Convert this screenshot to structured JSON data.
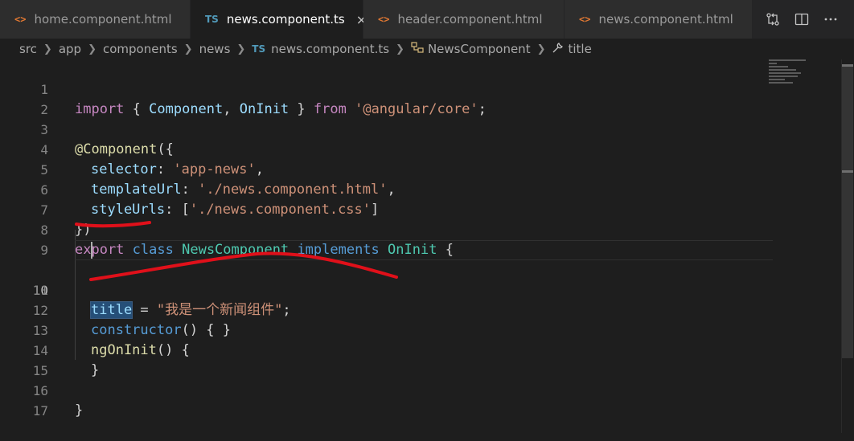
{
  "tabs": [
    {
      "label": "home.component.html",
      "icon": "html-file-icon",
      "glyph": "<>"
    },
    {
      "label": "news.component.ts",
      "icon": "typescript-file-icon",
      "glyph": "TS",
      "active": true,
      "close": "×"
    },
    {
      "label": "header.component.html",
      "icon": "html-file-icon",
      "glyph": "<>"
    },
    {
      "label": "news.component.html",
      "icon": "html-file-icon",
      "glyph": "<>"
    }
  ],
  "breadcrumb": {
    "parts": [
      "src",
      "app",
      "components",
      "news"
    ],
    "file_glyph": "TS",
    "file": "news.component.ts",
    "class_name": "NewsComponent",
    "member": "title"
  },
  "line_numbers": [
    "1",
    "2",
    "3",
    "4",
    "5",
    "6",
    "7",
    "8",
    "9",
    "10",
    "11",
    "12",
    "13",
    "14",
    "15",
    "16",
    "17"
  ],
  "code": {
    "l1": {
      "kw": "import",
      "open": " { ",
      "a": "Component",
      "comma": ", ",
      "b": "OnInit",
      "close": " } ",
      "from": "from",
      "space": " ",
      "path": "'@angular/core'",
      "semi": ";"
    },
    "l3": {
      "at": "@",
      "dec": "Component",
      "open": "({"
    },
    "l4": {
      "key": "selector",
      "colon": ": ",
      "val": "'app-news'",
      "comma": ","
    },
    "l5": {
      "key": "templateUrl",
      "colon": ": ",
      "val": "'./news.component.html'",
      "comma": ","
    },
    "l6": {
      "key": "styleUrls",
      "colon": ": [",
      "val": "'./news.component.css'",
      "close": "]"
    },
    "l7": {
      "text": "})"
    },
    "l8": {
      "export": "export",
      "class": "class",
      "name": "NewsComponent",
      "impl": "implements",
      "iface": "OnInit",
      "brace": " {"
    },
    "l10": {
      "prop": "title",
      "eq": " = ",
      "val": "\"我是一个新闻组件\"",
      "semi": ";"
    },
    "l12": {
      "fn": "constructor",
      "rest": "() { }"
    },
    "l13": {
      "fn": "ngOnInit",
      "rest": "() {"
    },
    "l14": {
      "text": "}"
    },
    "l16": {
      "text": "}"
    }
  },
  "colors": {
    "background": "#1e1e1e",
    "keyword": "#569cd6",
    "control_keyword": "#c586c0",
    "type": "#4ec9b0",
    "string": "#ce9178",
    "annotation_red": "#e0101a"
  }
}
